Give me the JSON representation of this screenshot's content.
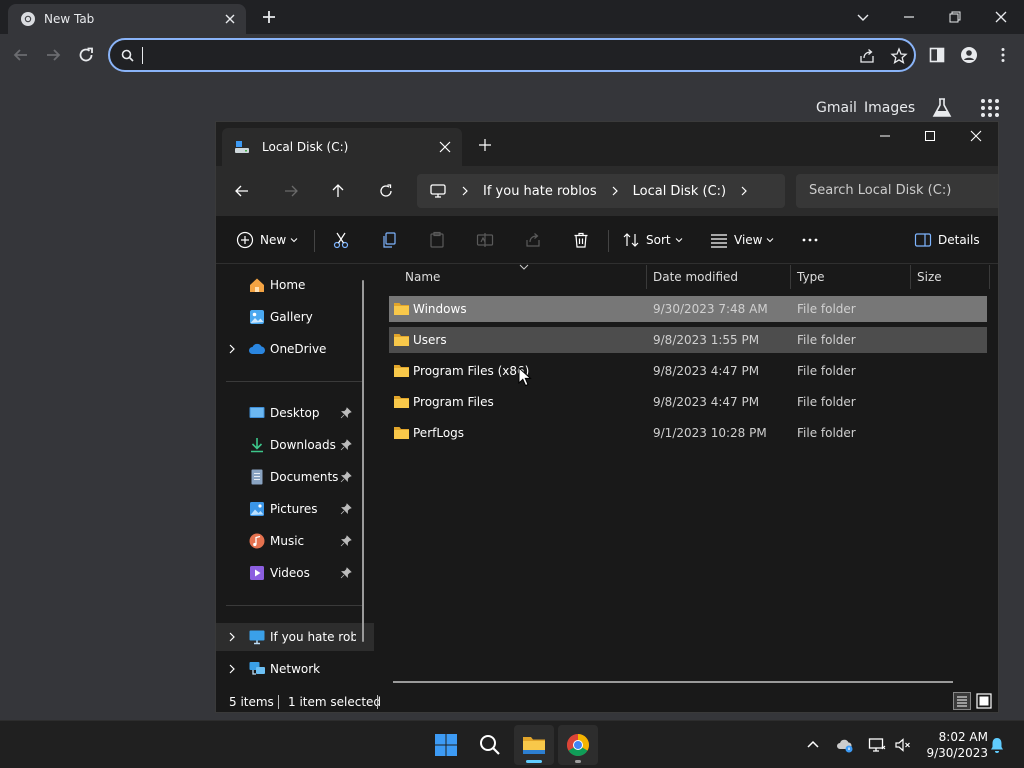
{
  "browser": {
    "tab_title": "New Tab",
    "omnibox_value": "",
    "links": {
      "gmail": "Gmail",
      "images": "Images"
    }
  },
  "explorer": {
    "tab_title": "Local Disk (C:)",
    "breadcrumbs": [
      "If you hate roblos",
      "Local Disk (C:)"
    ],
    "search_placeholder": "Search Local Disk (C:)",
    "commands": {
      "new": "New",
      "sort": "Sort",
      "view": "View",
      "details": "Details"
    },
    "nav": {
      "home": "Home",
      "gallery": "Gallery",
      "onedrive": "OneDrive",
      "desktop": "Desktop",
      "downloads": "Downloads",
      "documents": "Documents",
      "pictures": "Pictures",
      "music": "Music",
      "videos": "Videos",
      "this_pc": "If you hate roblos",
      "network": "Network"
    },
    "columns": {
      "name": "Name",
      "date": "Date modified",
      "type": "Type",
      "size": "Size"
    },
    "files": [
      {
        "name": "Windows",
        "date": "9/30/2023 7:48 AM",
        "type": "File folder"
      },
      {
        "name": "Users",
        "date": "9/8/2023 1:55 PM",
        "type": "File folder"
      },
      {
        "name": "Program Files (x86)",
        "date": "9/8/2023 4:47 PM",
        "type": "File folder"
      },
      {
        "name": "Program Files",
        "date": "9/8/2023 4:47 PM",
        "type": "File folder"
      },
      {
        "name": "PerfLogs",
        "date": "9/1/2023 10:28 PM",
        "type": "File folder"
      }
    ],
    "status": {
      "items": "5 items",
      "selected": "1 item selected"
    }
  },
  "taskbar": {
    "time": "8:02 AM",
    "date": "9/30/2023"
  },
  "colors": {
    "accent": "#8ab4f8",
    "folder": "#f8c84a",
    "windows_blue": "#3d9bf5"
  }
}
